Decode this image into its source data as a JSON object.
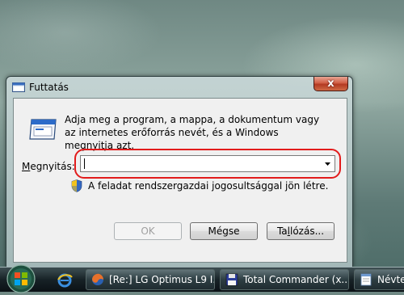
{
  "window": {
    "title": "Futtatás",
    "close_label": "x",
    "description": "Adja meg a program, a mappa, a dokumentum vagy az internetes erőforrás nevét, és a Windows megnyitja azt.",
    "open_label_accel": "M",
    "open_label_rest": "egnyitás:",
    "open_value": "",
    "admin_note": "A feladat rendszergazdai jogosultsággal jön létre.",
    "buttons": {
      "ok": "OK",
      "cancel": "Mégse",
      "browse_pre": "Ta",
      "browse_accel": "l",
      "browse_post": "lózás..."
    }
  },
  "taskbar": {
    "tasks": [
      {
        "label": "[Re:] LG Optimus L9 I...",
        "icon": "firefox-icon"
      },
      {
        "label": "Total Commander (x...",
        "icon": "floppy-icon"
      },
      {
        "label": "Névtele",
        "icon": "notepad-icon"
      }
    ]
  },
  "colors": {
    "highlight_ring": "#e21b1b",
    "close_button": "#c9452c"
  }
}
